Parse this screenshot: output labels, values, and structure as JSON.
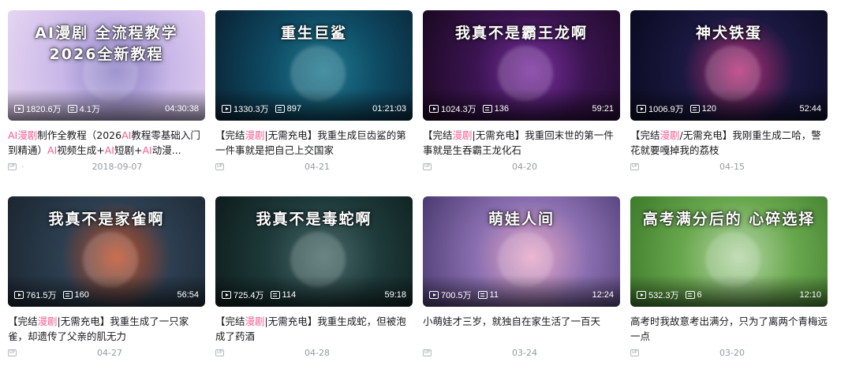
{
  "colors": {
    "highlight": "#f25d8e",
    "title": "#18191c",
    "meta": "#9499a0"
  },
  "videos": [
    {
      "art_title": "AI漫剧 全流程教学 2026全新教程",
      "views": "1820.6万",
      "danmaku": "4.1万",
      "duration": "04:30:38",
      "title_parts": [
        {
          "t": "AI漫剧",
          "hl": true
        },
        {
          "t": "制作全教程（2026",
          "hl": false
        },
        {
          "t": "AI",
          "hl": true
        },
        {
          "t": "教程零基础入门到精通）",
          "hl": false
        },
        {
          "t": "AI",
          "hl": true
        },
        {
          "t": "视频生成+",
          "hl": false
        },
        {
          "t": "AI",
          "hl": true
        },
        {
          "t": "短剧+",
          "hl": false
        },
        {
          "t": "AI",
          "hl": true
        },
        {
          "t": "动漫...",
          "hl": false
        }
      ],
      "badge": "UP",
      "author": "·",
      "date": "2018-09-07",
      "bg": [
        "#c9b8e8",
        "#8a7fc4",
        "#e7d5f2"
      ]
    },
    {
      "art_title": "重生巨鲨",
      "views": "1330.3万",
      "danmaku": "897",
      "duration": "01:21:03",
      "title_parts": [
        {
          "t": "【完结",
          "hl": false
        },
        {
          "t": "漫剧",
          "hl": true
        },
        {
          "t": "|无需充电】我重生成巨齿鲨的第一件事就是把自己上交国家",
          "hl": false
        }
      ],
      "badge": "UP",
      "author": "",
      "date": "04-21",
      "bg": [
        "#0e4a63",
        "#1f7a8f",
        "#0a2233"
      ]
    },
    {
      "art_title": "我真不是霸王龙啊",
      "views": "1024.3万",
      "danmaku": "136",
      "duration": "59:21",
      "title_parts": [
        {
          "t": "【完结",
          "hl": false
        },
        {
          "t": "漫剧",
          "hl": true
        },
        {
          "t": "|无需充电】我重回末世的第一件事就是生吞霸王龙化石",
          "hl": false
        }
      ],
      "badge": "UP",
      "author": "",
      "date": "04-20",
      "bg": [
        "#3a1450",
        "#7a2ea0",
        "#1a0820"
      ]
    },
    {
      "art_title": "神犬铁蛋",
      "views": "1006.9万",
      "danmaku": "120",
      "duration": "52:44",
      "title_parts": [
        {
          "t": "【完结",
          "hl": false
        },
        {
          "t": "漫剧",
          "hl": true
        },
        {
          "t": "/无需充电】我刚重生成二哈，警花就要嘎掉我的荔枝",
          "hl": false
        }
      ],
      "badge": "UP",
      "author": "",
      "date": "04-15",
      "bg": [
        "#1a1840",
        "#b8307a",
        "#0a0a20"
      ]
    },
    {
      "art_title": "我真不是家雀啊",
      "views": "761.5万",
      "danmaku": "160",
      "duration": "56:54",
      "title_parts": [
        {
          "t": "【完结",
          "hl": false
        },
        {
          "t": "漫剧",
          "hl": true
        },
        {
          "t": "|无需充电】我重生成了一只家雀，却遗传了父亲的肌无力",
          "hl": false
        }
      ],
      "badge": "UP",
      "author": "",
      "date": "04-27",
      "bg": [
        "#2c3e50",
        "#c0502a",
        "#1b2630"
      ]
    },
    {
      "art_title": "我真不是毒蛇啊",
      "views": "725.4万",
      "danmaku": "114",
      "duration": "59:18",
      "title_parts": [
        {
          "t": "【完结",
          "hl": false
        },
        {
          "t": "漫剧",
          "hl": true
        },
        {
          "t": "|无需充电】我重生成蛇，但被泡成了药酒",
          "hl": false
        }
      ],
      "badge": "UP",
      "author": "",
      "date": "04-28",
      "bg": [
        "#1e3a3a",
        "#4a6a6a",
        "#0e1c1c"
      ]
    },
    {
      "art_title": "萌娃人间",
      "views": "700.5万",
      "danmaku": "11",
      "duration": "12:24",
      "title_parts": [
        {
          "t": "小萌娃才三岁，就独自在家生活了一百天",
          "hl": false
        }
      ],
      "badge": "UP",
      "author": "",
      "date": "03-24",
      "bg": [
        "#8a6fb0",
        "#e8a8c8",
        "#4a3a70"
      ]
    },
    {
      "art_title": "高考满分后的 心碎选择",
      "views": "532.3万",
      "danmaku": "6",
      "duration": "12:10",
      "title_parts": [
        {
          "t": "高考时我故意考出满分，只为了离两个青梅远一点",
          "hl": false
        }
      ],
      "badge": "UP",
      "author": "",
      "date": "03-20",
      "bg": [
        "#6aa84f",
        "#b6d7a8",
        "#3d7a2a"
      ]
    }
  ]
}
